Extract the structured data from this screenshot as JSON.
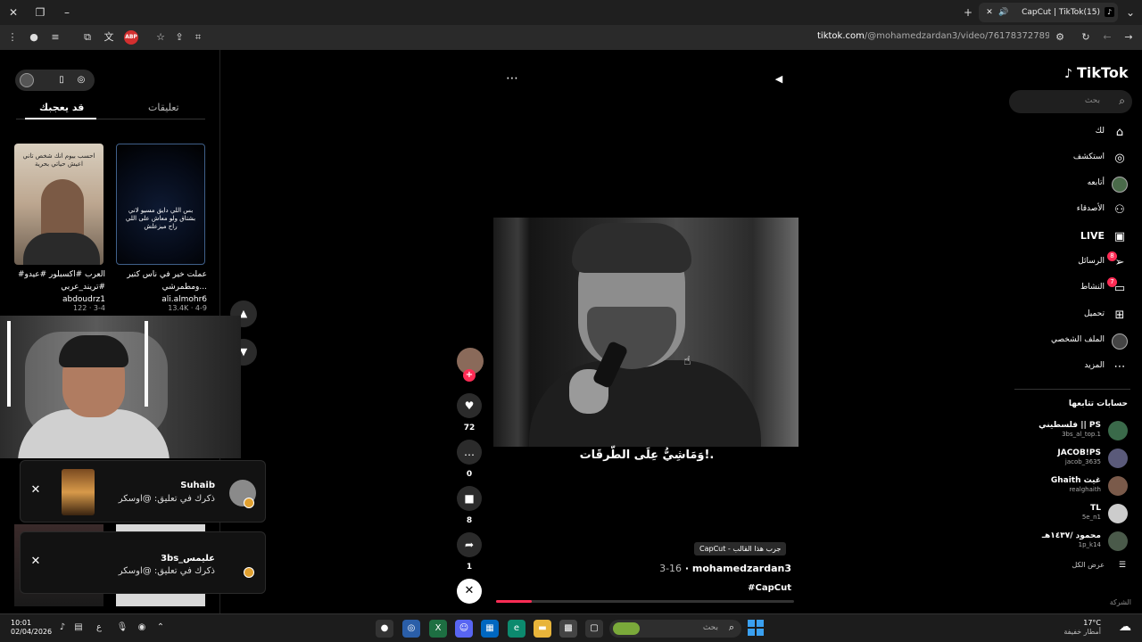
{
  "browser": {
    "tab_title": "CapCut | TikTok",
    "tab_count": "(15)",
    "url_domain": "tiktok.com",
    "url_path": "/@mohamedzardan3/video/7617837278974496007",
    "abp_label": "ABP"
  },
  "left_panel": {
    "tabs": {
      "comments": "تعليقات",
      "you_may_like": "قد يعجبك"
    },
    "cards": [
      {
        "thumb_text": "احسب بيوم انك شخص تاني اعيش حياتي بحرية",
        "caption": "#العرب #اكسبلور #عيدو #تريند_عربي #اكسبلورررر",
        "author": "abdoudrz1",
        "stats": "122 · 3-4"
      },
      {
        "thumb_text": "بس اللي دايق مسيو لاني بشتاق ولو معاش على اللي راح ميزعلش",
        "caption": "عملت خير في ناس كتير ومطمرشي...",
        "author": "ali.almohr6",
        "stats": "13.4K · 4-9"
      }
    ]
  },
  "notifications": [
    {
      "name": "Suhaib",
      "message": "ذكرك في تعليق: @اوسكر"
    },
    {
      "name": "3bs_عليمس",
      "message": "ذكرك في تعليق: @اوسكر"
    }
  ],
  "video": {
    "subtitle": "وَمَاشِيُّ عِلَى الطّرقَات!.",
    "template_badge": "CapCut - جرب هذا القالب",
    "author": "mohamedzardan3",
    "date": "3-16",
    "tag": "#CapCut",
    "progress_percent": 12
  },
  "actions": {
    "likes": "72",
    "comments": "0",
    "saves": "8",
    "shares": "1"
  },
  "sidebar": {
    "logo": "TikTok",
    "search_placeholder": "بحث",
    "nav": {
      "for_you": "لك",
      "explore": "استكشف",
      "following": "أتابعه",
      "friends": "الأصدقاء",
      "live": "LIVE",
      "messages": "الرسائل",
      "messages_badge": "8",
      "activity": "النشاط",
      "activity_badge": "7",
      "upload": "تحميل",
      "profile": "الملف الشخصي",
      "more": "المزيد"
    },
    "following_title": "حسابات تتابعها",
    "accounts": [
      {
        "name": "فلسطيني || PS",
        "handle": "3bs_al_top.1",
        "color": "#3a6a4a"
      },
      {
        "name": "JACOB!PS",
        "handle": "jacob_3635",
        "color": "#5a5a7a"
      },
      {
        "name": "Ghaith غيث",
        "handle": "realghaith",
        "color": "#7a5a4a"
      },
      {
        "name": "TL",
        "handle": "5e_n1",
        "color": "#cccccc"
      },
      {
        "name": "محمود /١٤٣٧هـ",
        "handle": "1p_k14",
        "color": "#4a5a4a"
      }
    ],
    "see_all": "عرض الكل",
    "company": "الشركة"
  },
  "taskbar": {
    "time": "10:01",
    "date": "02/04/2026",
    "lang": "ع",
    "search_placeholder": "بحث",
    "temp": "17°C",
    "weather": "أمطار خفيفة"
  },
  "colors": {
    "accent": "#fe2c55",
    "background": "#000000"
  }
}
